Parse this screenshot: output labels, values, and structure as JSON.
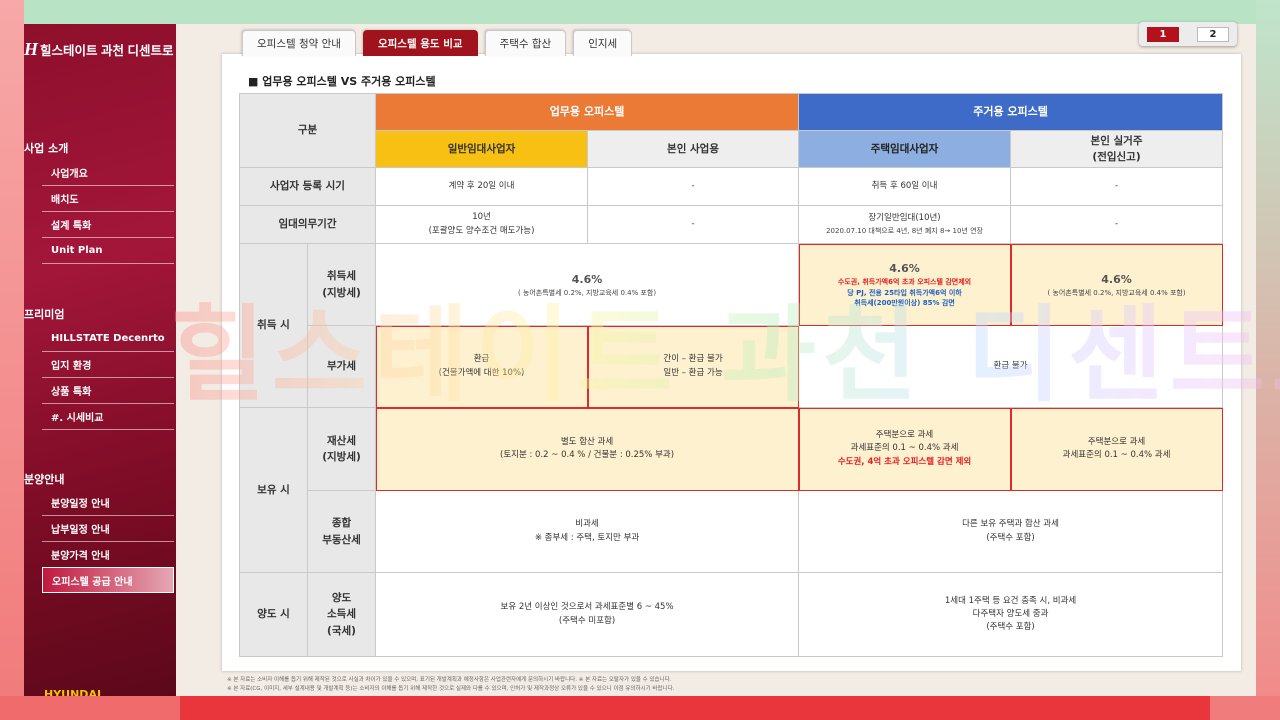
{
  "brand": {
    "name": "힐스테이트 과천 디센트로",
    "logo_mark": "H",
    "bottom_text": "HYUNDAI"
  },
  "sidebar": {
    "sections": [
      {
        "title": "사업 소개",
        "items": [
          {
            "label": "사업개요"
          },
          {
            "label": "배치도"
          },
          {
            "label": "설계 특화"
          },
          {
            "label": "Unit Plan"
          }
        ]
      },
      {
        "title": "프리미엄",
        "items": [
          {
            "label": "HILLSTATE Decenrto"
          },
          {
            "label": "입지 환경"
          },
          {
            "label": "상품 특화"
          },
          {
            "label": "#. 시세비교"
          }
        ]
      },
      {
        "title": "분양안내",
        "items": [
          {
            "label": "분양일정 안내"
          },
          {
            "label": "납부일정 안내"
          },
          {
            "label": "분양가격 안내"
          },
          {
            "label": "오피스텔 공급 안내"
          }
        ]
      }
    ]
  },
  "tabs": [
    {
      "label": "오피스텔 청약 안내"
    },
    {
      "label": "오피스텔 용도 비교"
    },
    {
      "label": "주택수 합산"
    },
    {
      "label": "인지세"
    }
  ],
  "pager": [
    "1",
    "2"
  ],
  "heading": "■ 업무용 오피스텔 VS 주거용 오피스텔",
  "table": {
    "h_category": "구분",
    "h_business": "업무용 오피스텔",
    "h_residential": "주거용 오피스텔",
    "sub_general_rental": "일반임대사업자",
    "sub_own_business": "본인 사업용",
    "sub_housing_rental": "주택임대사업자",
    "sub_own_residence_1": "본인 실거주",
    "sub_own_residence_2": "(전입신고)",
    "reg_label": "사업자 등록 시기",
    "reg_1": "계약 후 20일 이내",
    "reg_2": "-",
    "reg_3": "취득 후 60일 이내",
    "reg_4": "-",
    "lease_label": "임대의무기간",
    "lease_1a": "10년",
    "lease_1b": "(포괄양도 양수조건 매도가능)",
    "lease_2": "-",
    "lease_3a": "장기일반임대(10년)",
    "lease_3b": "2020.07.10 대책으로 4년, 8년 폐지 8→ 10년 연장",
    "lease_4": "-",
    "acq_label": "취득 시",
    "acqtax_label_1": "취득세",
    "acqtax_label_2": "(지방세)",
    "acqtax_biz_rate": "4.6%",
    "acqtax_biz_note": "( 농어촌특별세 0.2%, 지방교육세 0.4% 포함)",
    "acqtax_hr_rate": "4.6%",
    "acqtax_hr_red": "수도권, 취득가액6억 초과 오피스텔 감면제외",
    "acqtax_hr_blue1": "당 PJ, 전용 25타입 취득가액6억 이하",
    "acqtax_hr_blue2": "취득세(200만원이상) 85% 감면",
    "acqtax_or_rate": "4.6%",
    "acqtax_or_note": "( 농어촌특별세 0.2%, 지방교육세 0.4% 포함)",
    "vat_label": "부가세",
    "vat_1a": "환급",
    "vat_1b": "(건물가액에 대한 10%)",
    "vat_2a": "간이 – 환급 불가",
    "vat_2b": "일반 – 환급 가능",
    "vat_res": "환급 불가",
    "hold_label": "보유 시",
    "prop_label_1": "재산세",
    "prop_label_2": "(지방세)",
    "prop_biz_1": "별도 합산 과세",
    "prop_biz_2": "(토지분 : 0.2 ~ 0.4 % / 건물분 : 0.25% 부과)",
    "prop_hr_1": "주택분으로 과세",
    "prop_hr_2": "과세표준의 0.1 ~ 0.4% 과세",
    "prop_hr_red": "수도권, 4억 초과 오피스텔 감면 제외",
    "prop_or_1": "주택분으로 과세",
    "prop_or_2": "과세표준의 0.1 ~ 0.4% 과세",
    "comp_label_1": "종합",
    "comp_label_2": "부동산세",
    "comp_biz_1": "비과세",
    "comp_biz_2": "※ 종부세 : 주택, 토지만 부과",
    "comp_res_1": "다른 보유 주택과 합산 과세",
    "comp_res_2": "(주택수 포함)",
    "transfer_label": "양도 시",
    "cgt_label_1": "양도",
    "cgt_label_2": "소득세",
    "cgt_label_3": "(국세)",
    "cgt_biz_1": "보유 2년 이상인 것으로서 과세표준별 6 ~ 45%",
    "cgt_biz_2": "(주택수 미포함)",
    "cgt_res_1": "1세대 1주택 등 요건 충족 시, 비과세",
    "cgt_res_2": "다주택자 양도세 중과",
    "cgt_res_3": "(주택수 포함)"
  },
  "watermark": "힐스테이트 과천 디센트로",
  "footnotes": [
    "※ 본 자료는 소비자 이해를 돕기 위해 제작된 것으로 사실과 차이가 있을 수 있으며, 표기된 개발계획과 예정사항은 사업관련자에게 문의하시기 바랍니다.    ※ 본 자료는 오탈자가 있을 수 있습니다.",
    "※ 본 자료(CG, 이미지, 세부 설계내용 및 개발계획 등)는 소비자의 이해를 돕기 위해 제작한 것으로 실제와 다를 수 있으며, 인허가 및 제작과정상 오류가 있을 수 있으니 이점 유의하시기 바랍니다."
  ],
  "colors": {
    "sidebar": "#8e0f2c",
    "tab_active": "#a0131c",
    "business_header": "#ea7a35",
    "residential_header": "#3e6bc7",
    "general_rental": "#f7c013",
    "housing_rental": "#8caee0",
    "highlight": "#fef1d0",
    "emphasis_red": "#e02020",
    "emphasis_blue": "#1e5fc0"
  }
}
